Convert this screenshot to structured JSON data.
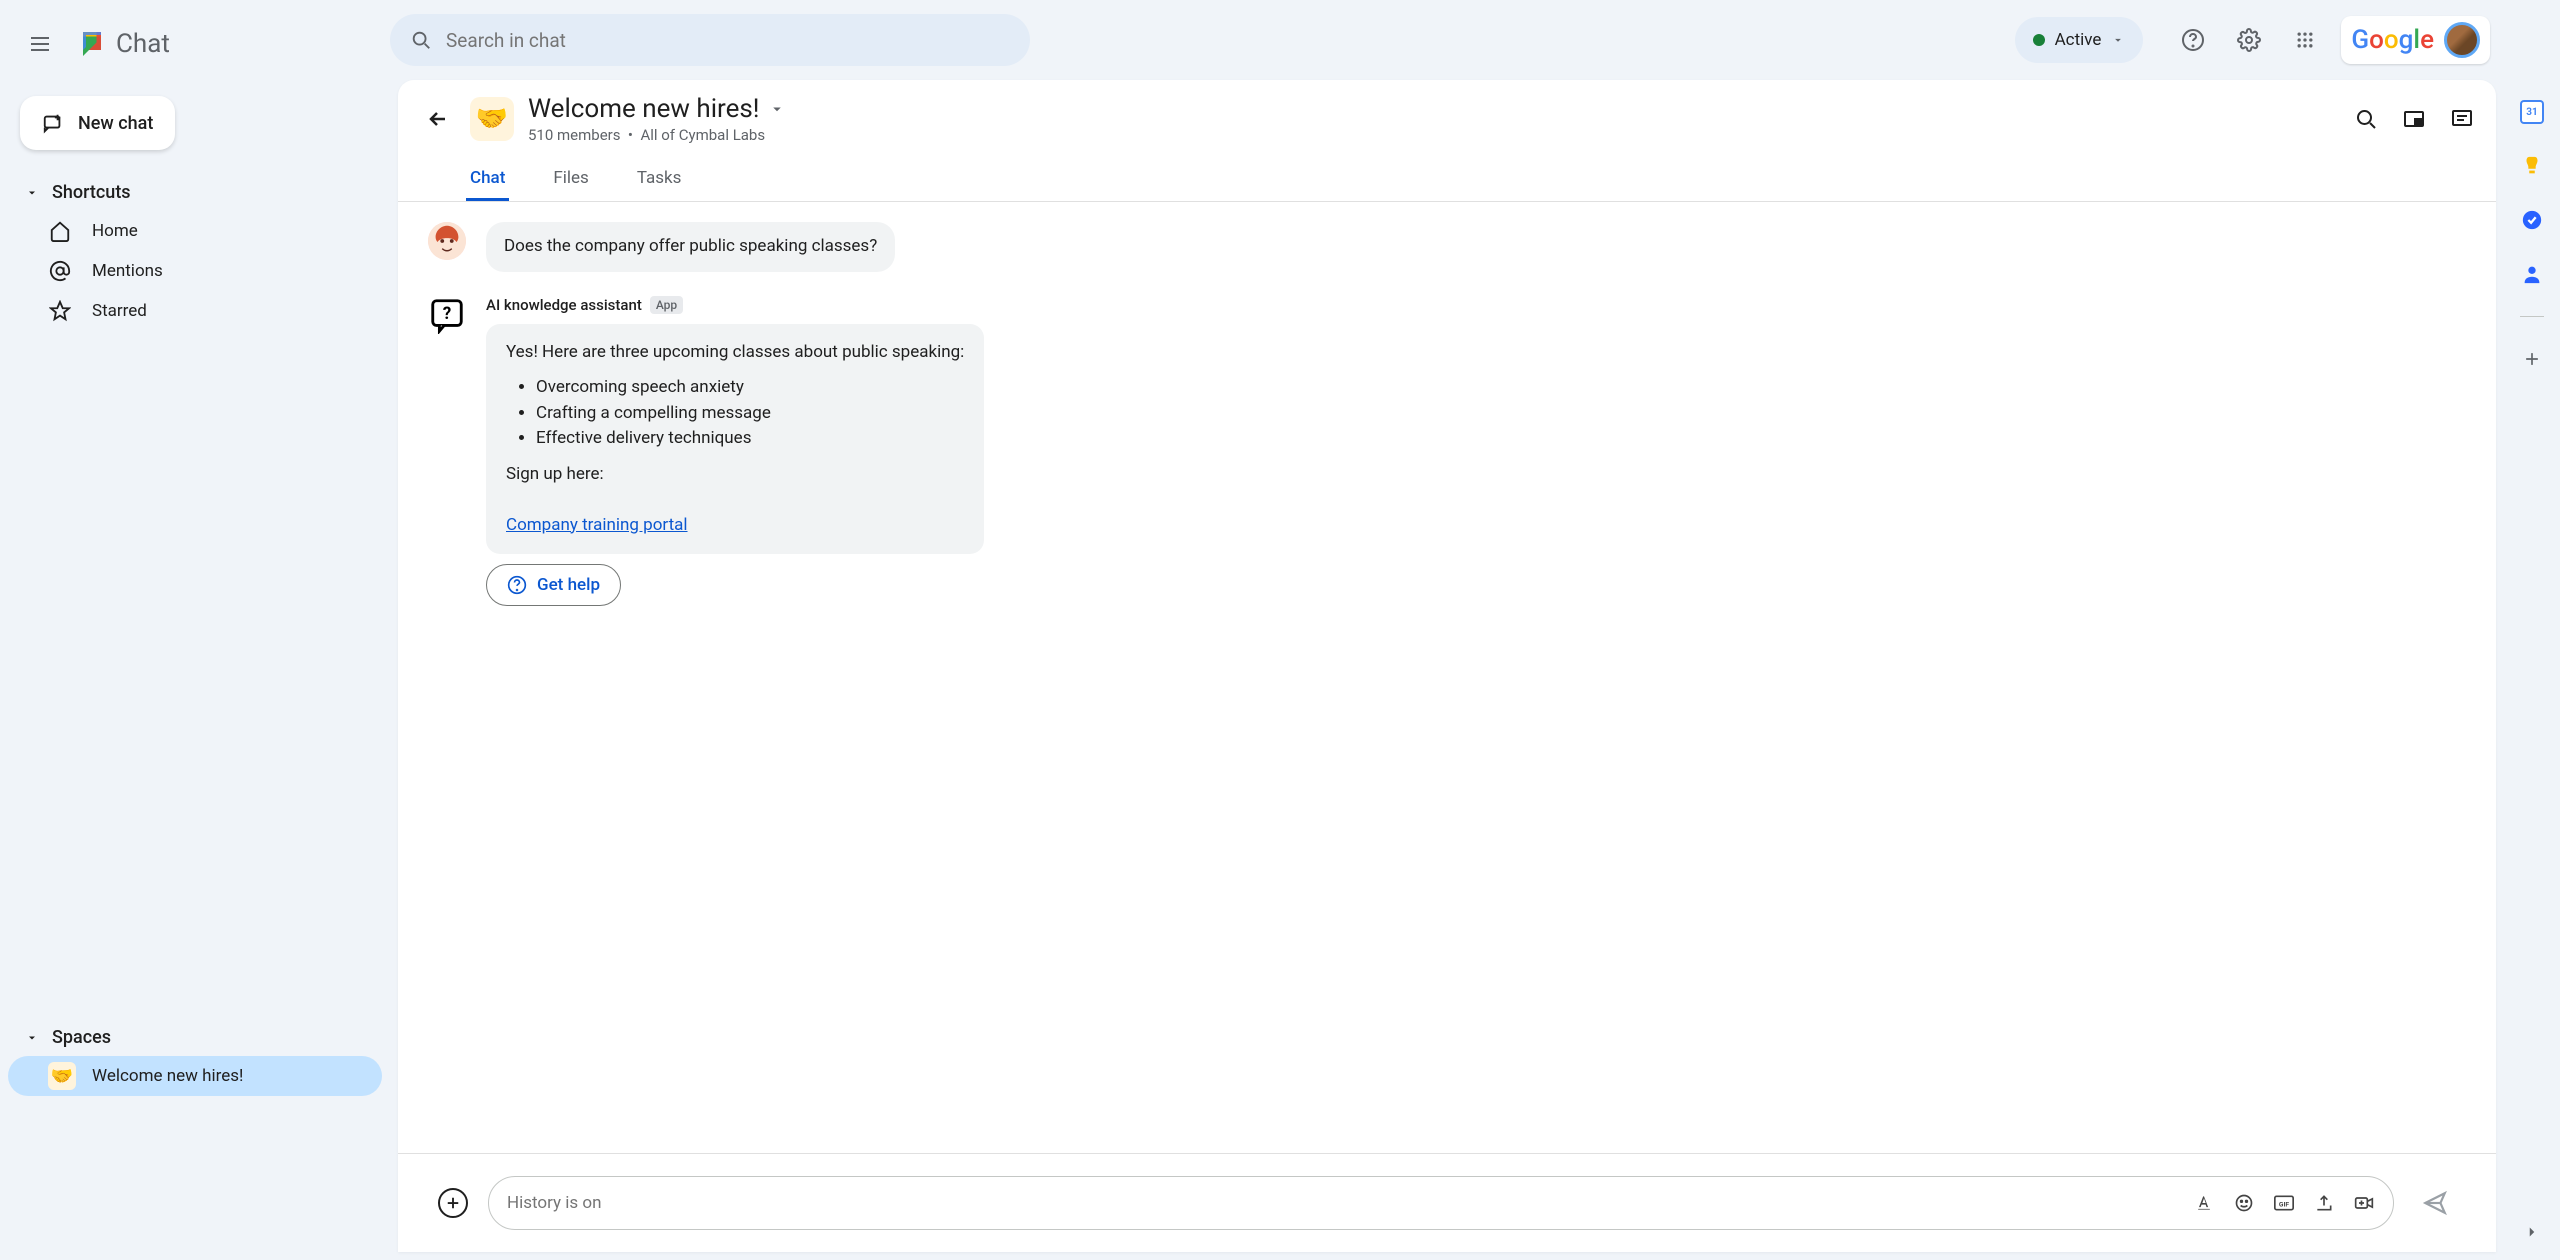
{
  "app_name": "Chat",
  "search": {
    "placeholder": "Search in chat"
  },
  "status": {
    "label": "Active"
  },
  "new_chat_label": "New chat",
  "sections": {
    "shortcuts_label": "Shortcuts",
    "spaces_label": "Spaces",
    "items": {
      "home": "Home",
      "mentions": "Mentions",
      "starred": "Starred"
    }
  },
  "spaces": [
    {
      "emoji": "🤝",
      "name": "Welcome new hires!",
      "active": true
    }
  ],
  "space": {
    "emoji": "🤝",
    "title": "Welcome new hires!",
    "members": "510 members",
    "scope": "All of Cymbal Labs",
    "tabs": [
      "Chat",
      "Files",
      "Tasks"
    ],
    "active_tab": 0
  },
  "messages": {
    "user_question": "Does the company offer public speaking classes?",
    "assistant": {
      "name": "AI knowledge assistant",
      "badge": "App",
      "intro": "Yes! Here are three upcoming classes about public speaking:",
      "classes": [
        "Overcoming speech anxiety",
        "Crafting a compelling message",
        "Effective delivery techniques"
      ],
      "signup_label": "Sign up here:",
      "link_text": "Company training portal",
      "action_label": "Get help"
    }
  },
  "composer": {
    "placeholder": "History is on"
  },
  "google_brand": "Google"
}
